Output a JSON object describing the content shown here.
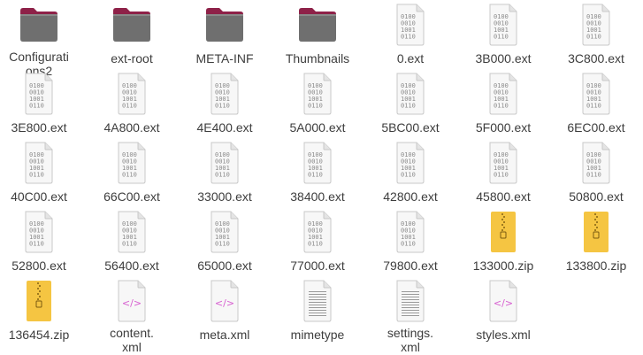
{
  "window": {
    "title": ""
  },
  "files": [
    {
      "name": "Configurations2",
      "label_lines": [
        "Configurati",
        "ons2"
      ],
      "type": "folder"
    },
    {
      "name": "ext-root",
      "label_lines": [
        "ext-root"
      ],
      "type": "folder"
    },
    {
      "name": "META-INF",
      "label_lines": [
        "META-INF"
      ],
      "type": "folder"
    },
    {
      "name": "Thumbnails",
      "label_lines": [
        "Thumbnails"
      ],
      "type": "folder"
    },
    {
      "name": "0.ext",
      "label_lines": [
        "0.ext"
      ],
      "type": "binary"
    },
    {
      "name": "3B000.ext",
      "label_lines": [
        "3B000.ext"
      ],
      "type": "binary"
    },
    {
      "name": "3C800.ext",
      "label_lines": [
        "3C800.ext"
      ],
      "type": "binary"
    },
    {
      "name": "3E800.ext",
      "label_lines": [
        "3E800.ext"
      ],
      "type": "binary"
    },
    {
      "name": "4A800.ext",
      "label_lines": [
        "4A800.ext"
      ],
      "type": "binary"
    },
    {
      "name": "4E400.ext",
      "label_lines": [
        "4E400.ext"
      ],
      "type": "binary"
    },
    {
      "name": "5A000.ext",
      "label_lines": [
        "5A000.ext"
      ],
      "type": "binary"
    },
    {
      "name": "5BC00.ext",
      "label_lines": [
        "5BC00.ext"
      ],
      "type": "binary"
    },
    {
      "name": "5F000.ext",
      "label_lines": [
        "5F000.ext"
      ],
      "type": "binary"
    },
    {
      "name": "6EC00.ext",
      "label_lines": [
        "6EC00.ext"
      ],
      "type": "binary"
    },
    {
      "name": "40C00.ext",
      "label_lines": [
        "40C00.ext"
      ],
      "type": "binary"
    },
    {
      "name": "66C00.ext",
      "label_lines": [
        "66C00.ext"
      ],
      "type": "binary"
    },
    {
      "name": "33000.ext",
      "label_lines": [
        "33000.ext"
      ],
      "type": "binary"
    },
    {
      "name": "38400.ext",
      "label_lines": [
        "38400.ext"
      ],
      "type": "binary"
    },
    {
      "name": "42800.ext",
      "label_lines": [
        "42800.ext"
      ],
      "type": "binary"
    },
    {
      "name": "45800.ext",
      "label_lines": [
        "45800.ext"
      ],
      "type": "binary"
    },
    {
      "name": "50800.ext",
      "label_lines": [
        "50800.ext"
      ],
      "type": "binary"
    },
    {
      "name": "52800.ext",
      "label_lines": [
        "52800.ext"
      ],
      "type": "binary"
    },
    {
      "name": "56400.ext",
      "label_lines": [
        "56400.ext"
      ],
      "type": "binary"
    },
    {
      "name": "65000.ext",
      "label_lines": [
        "65000.ext"
      ],
      "type": "binary"
    },
    {
      "name": "77000.ext",
      "label_lines": [
        "77000.ext"
      ],
      "type": "binary"
    },
    {
      "name": "79800.ext",
      "label_lines": [
        "79800.ext"
      ],
      "type": "binary"
    },
    {
      "name": "133000.zip",
      "label_lines": [
        "133000.zip"
      ],
      "type": "zip"
    },
    {
      "name": "133800.zip",
      "label_lines": [
        "133800.zip"
      ],
      "type": "zip"
    },
    {
      "name": "136454.zip",
      "label_lines": [
        "136454.zip"
      ],
      "type": "zip"
    },
    {
      "name": "content.xml",
      "label_lines": [
        "content.",
        "xml"
      ],
      "type": "xml"
    },
    {
      "name": "meta.xml",
      "label_lines": [
        "meta.xml"
      ],
      "type": "xml"
    },
    {
      "name": "mimetype",
      "label_lines": [
        "mimetype"
      ],
      "type": "text"
    },
    {
      "name": "settings.xml",
      "label_lines": [
        "settings.",
        "xml"
      ],
      "type": "text"
    },
    {
      "name": "styles.xml",
      "label_lines": [
        "styles.xml"
      ],
      "type": "xml"
    }
  ],
  "icon_names": {
    "folder": "folder-icon",
    "binary": "binary-file-icon",
    "zip": "zip-archive-icon",
    "xml": "xml-file-icon",
    "text": "text-file-icon"
  },
  "colors": {
    "folder_tab": "#8e2148",
    "folder_body": "#6f6f6f",
    "folder_body_light": "#8a8a8a",
    "zip": "#f5c542",
    "xml_glyph": "#d75fd0",
    "file_paper": "#f7f7f7",
    "file_border": "#c8c8c8",
    "binary_text": "#8a8a8a",
    "text_lines": "#9a9a9a",
    "label_text": "#3d3d3d"
  },
  "binary_glyph_lines": [
    "0100",
    "0010",
    "1001",
    "0110"
  ],
  "xml_glyph": "</>"
}
